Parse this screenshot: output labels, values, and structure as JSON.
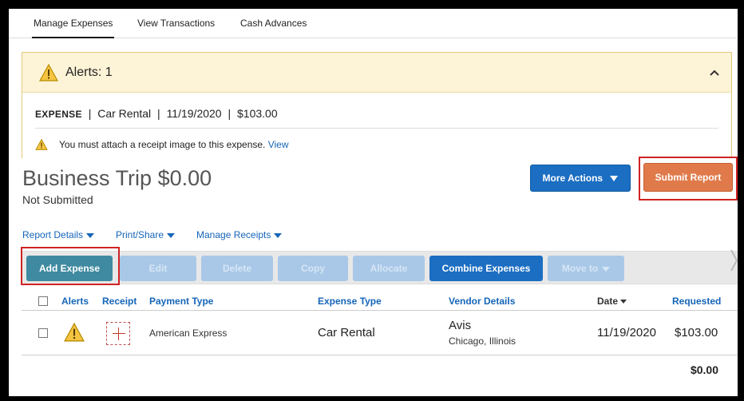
{
  "tabs": [
    {
      "label": "Manage Expenses",
      "active": true
    },
    {
      "label": "View Transactions",
      "active": false
    },
    {
      "label": "Cash Advances",
      "active": false
    }
  ],
  "alerts": {
    "title": "Alerts: 1",
    "expense_kind": "EXPENSE",
    "expense_sep1": "|",
    "expense_type": "Car Rental",
    "expense_sep2": "|",
    "expense_date": "11/19/2020",
    "expense_sep3": "|",
    "expense_amount": "$103.00",
    "message": "You must attach a receipt image to this expense.",
    "view_link": "View"
  },
  "report": {
    "title": "Business Trip $0.00",
    "status": "Not Submitted",
    "more_actions_label": "More Actions",
    "submit_label": "Submit Report"
  },
  "submenus": [
    "Report Details",
    "Print/Share",
    "Manage Receipts"
  ],
  "toolbar": {
    "add_expense": "Add Expense",
    "edit": "Edit",
    "delete": "Delete",
    "copy": "Copy",
    "allocate": "Allocate",
    "combine": "Combine Expenses",
    "move_to": "Move to"
  },
  "table": {
    "headers": {
      "alerts": "Alerts",
      "receipt": "Receipt",
      "payment_type": "Payment Type",
      "expense_type": "Expense Type",
      "vendor": "Vendor Details",
      "date": "Date",
      "requested": "Requested"
    },
    "rows": [
      {
        "payment_type": "American Express",
        "expense_type": "Car Rental",
        "vendor_name": "Avis",
        "vendor_location": "Chicago, Illinois",
        "date": "11/19/2020",
        "requested": "$103.00"
      }
    ],
    "total": "$0.00"
  },
  "colors": {
    "primary_blue": "#1b6ec2",
    "submit_orange": "#e07a4a",
    "highlight_red": "#d02323",
    "alert_bg": "#fdf3d6"
  }
}
